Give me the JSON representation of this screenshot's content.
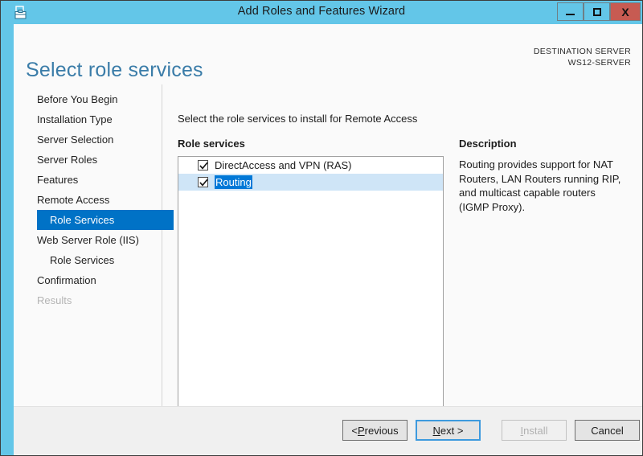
{
  "window": {
    "title": "Add Roles and Features Wizard",
    "icon": "wizard-toolbox-icon",
    "controls": {
      "minimize": "minimize-icon",
      "maximize": "maximize-icon",
      "close": "X"
    },
    "chrome_color": "#63c6e8",
    "close_color": "#c75b52"
  },
  "header": {
    "page_title": "Select role services",
    "destination_label": "DESTINATION SERVER",
    "destination_server": "WS12-SERVER",
    "title_color": "#3a7ca8"
  },
  "sidebar": {
    "items": [
      {
        "label": "Before You Begin",
        "selected": false,
        "sub": false,
        "disabled": false
      },
      {
        "label": "Installation Type",
        "selected": false,
        "sub": false,
        "disabled": false
      },
      {
        "label": "Server Selection",
        "selected": false,
        "sub": false,
        "disabled": false
      },
      {
        "label": "Server Roles",
        "selected": false,
        "sub": false,
        "disabled": false
      },
      {
        "label": "Features",
        "selected": false,
        "sub": false,
        "disabled": false
      },
      {
        "label": "Remote Access",
        "selected": false,
        "sub": false,
        "disabled": false
      },
      {
        "label": "Role Services",
        "selected": true,
        "sub": true,
        "disabled": false
      },
      {
        "label": "Web Server Role (IIS)",
        "selected": false,
        "sub": false,
        "disabled": false
      },
      {
        "label": "Role Services",
        "selected": false,
        "sub": true,
        "disabled": false
      },
      {
        "label": "Confirmation",
        "selected": false,
        "sub": false,
        "disabled": false
      },
      {
        "label": "Results",
        "selected": false,
        "sub": false,
        "disabled": true
      }
    ],
    "selected_color": "#0072c6"
  },
  "main": {
    "instruction": "Select the role services to install for Remote Access",
    "role_services_label": "Role services",
    "role_services": [
      {
        "label": "DirectAccess and VPN (RAS)",
        "checked": true,
        "selected": false
      },
      {
        "label": "Routing",
        "checked": true,
        "selected": true
      }
    ],
    "row_selection_color": "#cfe5f7",
    "text_selection_color": "#0078d7"
  },
  "description": {
    "title": "Description",
    "body": "Routing provides support for NAT Routers, LAN Routers running RIP, and multicast capable routers (IGMP Proxy)."
  },
  "footer": {
    "previous": {
      "pre": "< ",
      "accel": "P",
      "post": "revious",
      "disabled": false
    },
    "next": {
      "pre": "",
      "accel": "N",
      "post": "ext >",
      "disabled": false,
      "default": true
    },
    "install": {
      "pre": "",
      "accel": "I",
      "post": "nstall",
      "disabled": true
    },
    "cancel": {
      "label": "Cancel",
      "disabled": false
    }
  }
}
